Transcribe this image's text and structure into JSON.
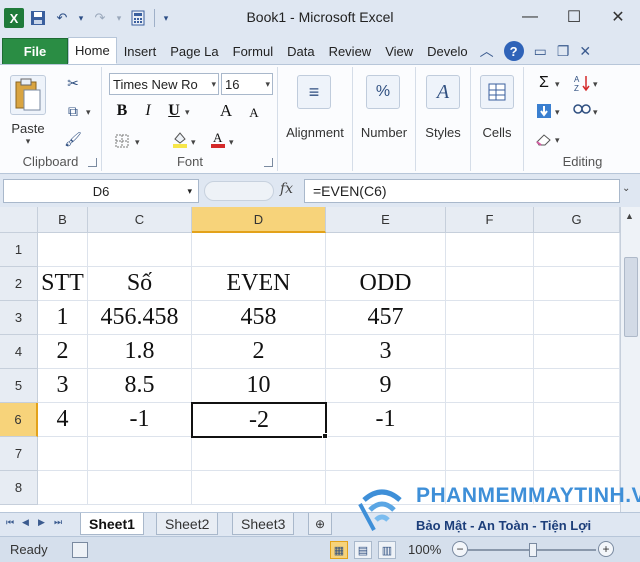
{
  "window": {
    "title": "Book1 - Microsoft Excel",
    "app_badge": "X",
    "minimize": "—",
    "maximize": "☐",
    "close": "✕"
  },
  "ribbon_tabs": [
    "File",
    "Home",
    "Insert",
    "Page La",
    "Formul",
    "Data",
    "Review",
    "View",
    "Develo"
  ],
  "ribbon": {
    "clipboard": {
      "label": "Clipboard",
      "paste": "Paste"
    },
    "font": {
      "label": "Font",
      "name": "Times New Ro",
      "size": "16",
      "bold": "B",
      "italic": "I",
      "underline": "U",
      "grow": "A",
      "shrink": "A",
      "fill_color": "#f7e64a",
      "font_color": "#d42a2a"
    },
    "alignment": {
      "label": "Alignment"
    },
    "number": {
      "label": "Number",
      "icon_text": "%"
    },
    "styles": {
      "label": "Styles"
    },
    "cells": {
      "label": "Cells"
    },
    "editing": {
      "label": "Editing"
    }
  },
  "formula_bar": {
    "name_box": "D6",
    "fx": "fx",
    "formula": "=EVEN(C6)"
  },
  "columns": [
    "B",
    "C",
    "D",
    "E",
    "F",
    "G"
  ],
  "rows": [
    "1",
    "2",
    "3",
    "4",
    "5",
    "6",
    "7",
    "8"
  ],
  "table": {
    "headers": [
      "STT",
      "Số",
      "EVEN",
      "ODD"
    ],
    "data": [
      [
        "1",
        "456.458",
        "458",
        "457"
      ],
      [
        "2",
        "1.8",
        "2",
        "3"
      ],
      [
        "3",
        "8.5",
        "10",
        "9"
      ],
      [
        "4",
        "-1",
        "-2",
        "-1"
      ]
    ]
  },
  "sheets": [
    "Sheet1",
    "Sheet2",
    "Sheet3"
  ],
  "status": {
    "ready": "Ready",
    "zoom": "100%",
    "zoom_minus": "−",
    "zoom_plus": "+"
  },
  "watermark": {
    "line1": "PHANMEMMAYTINH.VN",
    "line2": "Bảo Mật - An Toàn - Tiện Lợi"
  },
  "colors": {
    "file_tab": "#2a8d44",
    "selection_header": "#f7d37a",
    "watermark_blue": "#3e8fd8"
  }
}
